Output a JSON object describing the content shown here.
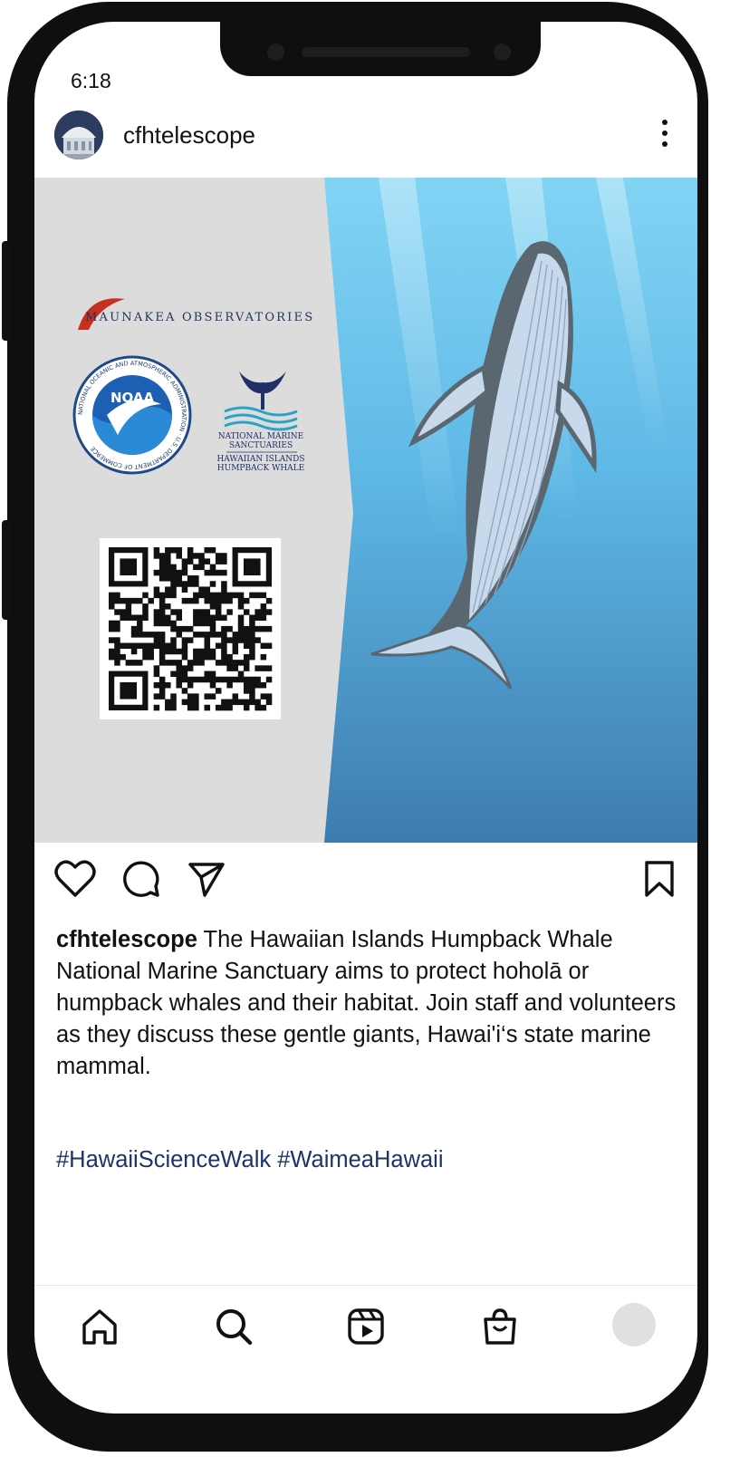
{
  "status_bar": {
    "time": "6:18"
  },
  "post": {
    "username": "cfhtelescope",
    "image": {
      "org_name": "MAUNAKEA OBSERVATORIES",
      "noaa_ring_text": "NATIONAL OCEANIC AND ATMOSPHERIC ADMINISTRATION · U.S. DEPARTMENT OF COMMERCE",
      "noaa_label": "NOAA",
      "sanctuary_line1": "NATIONAL MARINE",
      "sanctuary_line2": "SANCTUARIES",
      "sanctuary_line3": "HAWAIIAN ISLANDS",
      "sanctuary_line4": "HUMPBACK WHALE"
    },
    "caption_username": "cfhtelescope",
    "caption_text": "The Hawaiian Islands Humpback Whale National Marine Sanctuary aims to protect hoholā or humpback whales and their habitat. Join staff and volunteers as they discuss these gentle giants, Hawai'i‘s state marine mammal.",
    "hashtags": "#HawaiiScienceWalk #WaimeaHawaii"
  },
  "actions": {
    "like": "heart-icon",
    "comment": "comment-icon",
    "share": "send-icon",
    "save": "bookmark-icon"
  },
  "tabbar": {
    "items": [
      "home-icon",
      "search-icon",
      "reels-icon",
      "shop-icon",
      "profile-avatar"
    ]
  },
  "colors": {
    "frame": "#0f0f0f",
    "panel_gray": "#dcdcdc",
    "ocean_top": "#7fd3f4",
    "ocean_bottom": "#3f7fb0",
    "hashtag": "#22306a"
  }
}
